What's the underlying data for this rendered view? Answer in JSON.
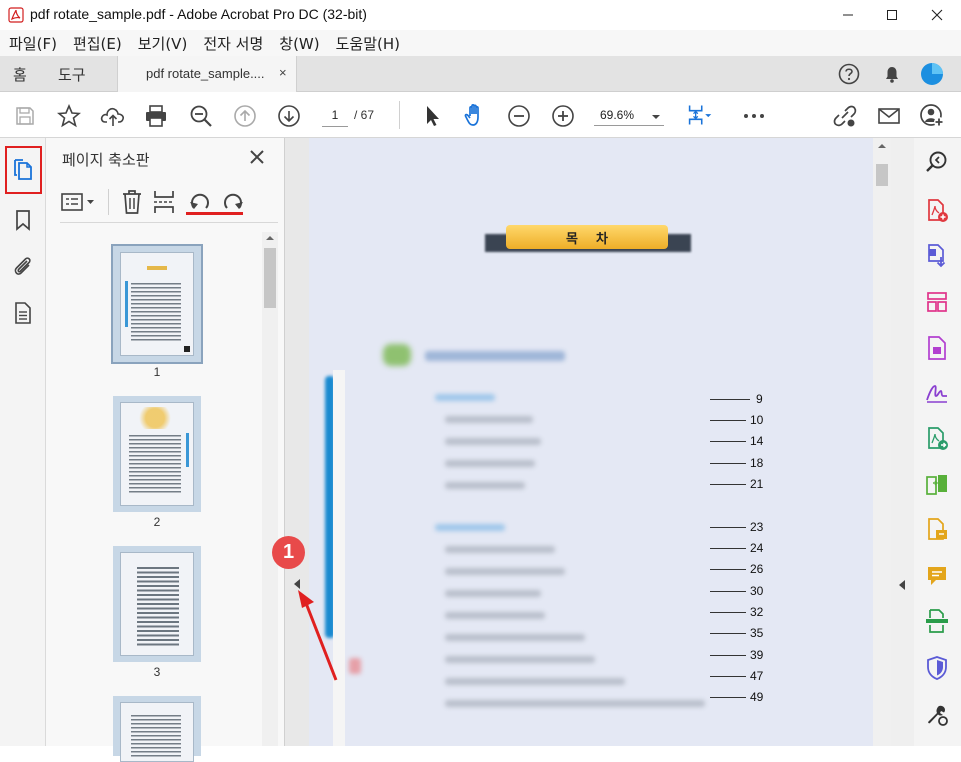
{
  "window": {
    "title": "pdf rotate_sample.pdf - Adobe Acrobat Pro DC (32-bit)",
    "icon": "acrobat-pdf-icon"
  },
  "menubar": {
    "items": [
      "파일(F)",
      "편집(E)",
      "보기(V)",
      "전자 서명",
      "창(W)",
      "도움말(H)"
    ]
  },
  "tabs": {
    "home": "홈",
    "tools": "도구",
    "document": "pdf rotate_sample....",
    "close": "×"
  },
  "toolbar": {
    "current_page": "1",
    "page_total": "/ 67",
    "zoom": "69.6%"
  },
  "thumbnail_panel": {
    "title": "페이지 축소판",
    "close": "×",
    "thumbnails": [
      {
        "number": "1"
      },
      {
        "number": "2"
      },
      {
        "number": "3"
      }
    ]
  },
  "document": {
    "toc_title": "목    차",
    "toc_page_numbers": [
      "9",
      "10",
      "14",
      "18",
      "21",
      "23",
      "24",
      "26",
      "30",
      "32",
      "35",
      "39",
      "47",
      "49"
    ]
  },
  "annotation": {
    "badge": "1",
    "badge_color": "#e84a4a",
    "arrow_color": "#e02020"
  },
  "colors": {
    "accent_blue": "#1a73d9",
    "highlight_red": "#e02020",
    "toc_banner": "#f2b730"
  }
}
